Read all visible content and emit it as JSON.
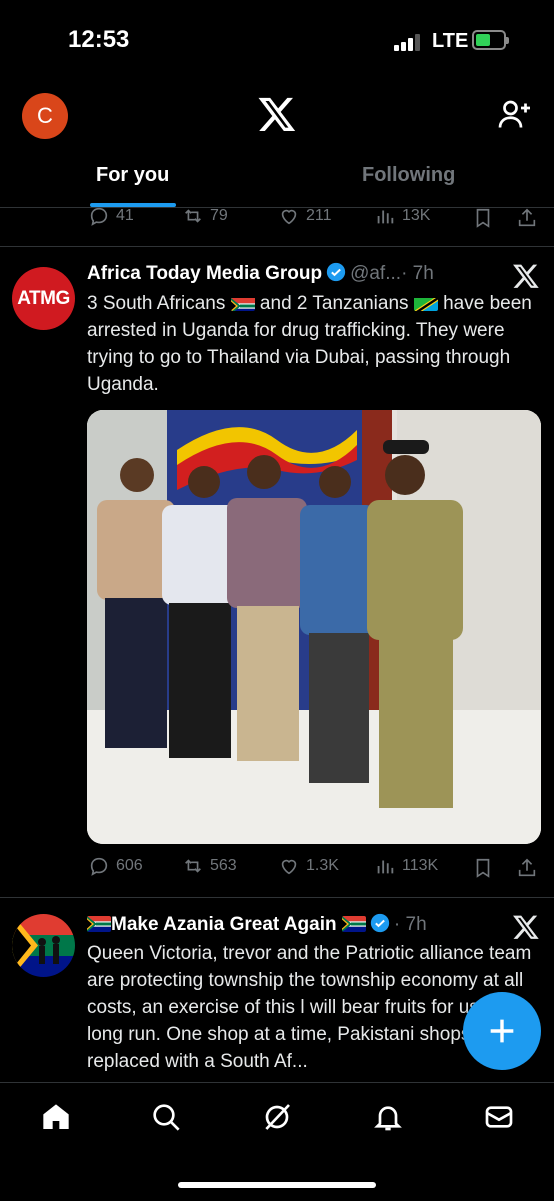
{
  "status_bar": {
    "time": "12:53",
    "network": "LTE"
  },
  "header": {
    "avatar_initial": "C",
    "tabs": [
      {
        "label": "For you",
        "active": true
      },
      {
        "label": "Following",
        "active": false
      }
    ]
  },
  "prev_tweet_actions": {
    "replies": "41",
    "reposts": "79",
    "likes": "211",
    "views": "13K"
  },
  "tweet1": {
    "avatar_text": "ATMG",
    "name": "Africa Today Media Group",
    "handle": "@af...",
    "time": "· 7h",
    "text_line1_a": "3 South Africans ",
    "text_line1_b": " and 2 Tanzanians ",
    "text_line1_c": " have",
    "text_rest": "been arrested in Uganda for drug trafficking. They were trying to go to Thailand via Dubai, passing through Uganda.",
    "actions": {
      "replies": "606",
      "reposts": "563",
      "likes": "1.3K",
      "views": "113K"
    }
  },
  "tweet2": {
    "name": "Make Azania Great Again",
    "time": "· 7h",
    "text": "Queen Victoria, trevor and the Patriotic alliance team are protecting township the township economy at all costs, an exercise of this l will bear fruits for us in the long run. One shop at a time, Pakistani shops will be replaced with a South Af..."
  },
  "colors": {
    "accent": "#1d9bf0",
    "muted": "#71767b",
    "atmg_red": "#d01a20"
  },
  "bottom_nav": [
    "home-icon",
    "search-icon",
    "grok-icon",
    "notifications-icon",
    "messages-icon"
  ]
}
